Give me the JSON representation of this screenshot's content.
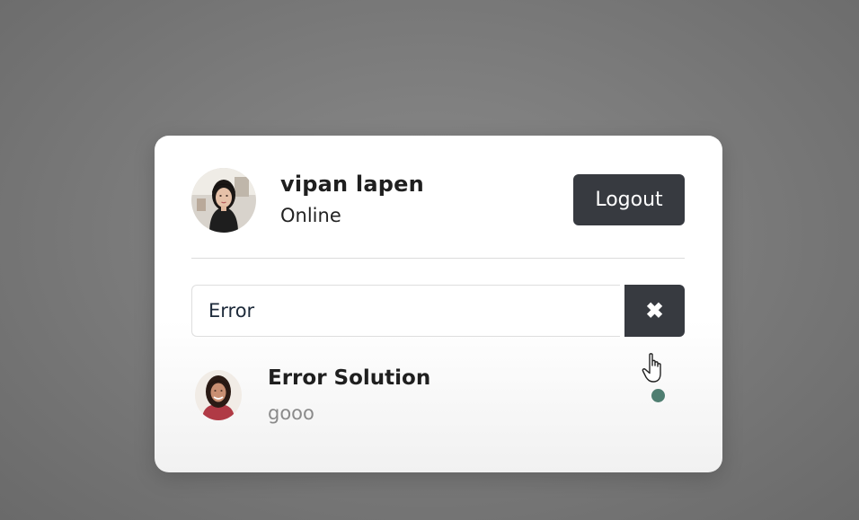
{
  "user": {
    "name": "vipan lapen",
    "status": "Online",
    "avatar_icon": "user-avatar"
  },
  "header": {
    "logout_label": "Logout"
  },
  "search": {
    "value": "Error",
    "placeholder": "",
    "clear_icon": "close-icon",
    "clear_symbol": "✖"
  },
  "results": [
    {
      "name": "Error Solution",
      "message": "gooo",
      "status": "online",
      "status_color": "#4f7e71",
      "avatar_icon": "contact-avatar"
    }
  ],
  "colors": {
    "button_bg": "#373a40",
    "background": "#7c7c7c"
  }
}
